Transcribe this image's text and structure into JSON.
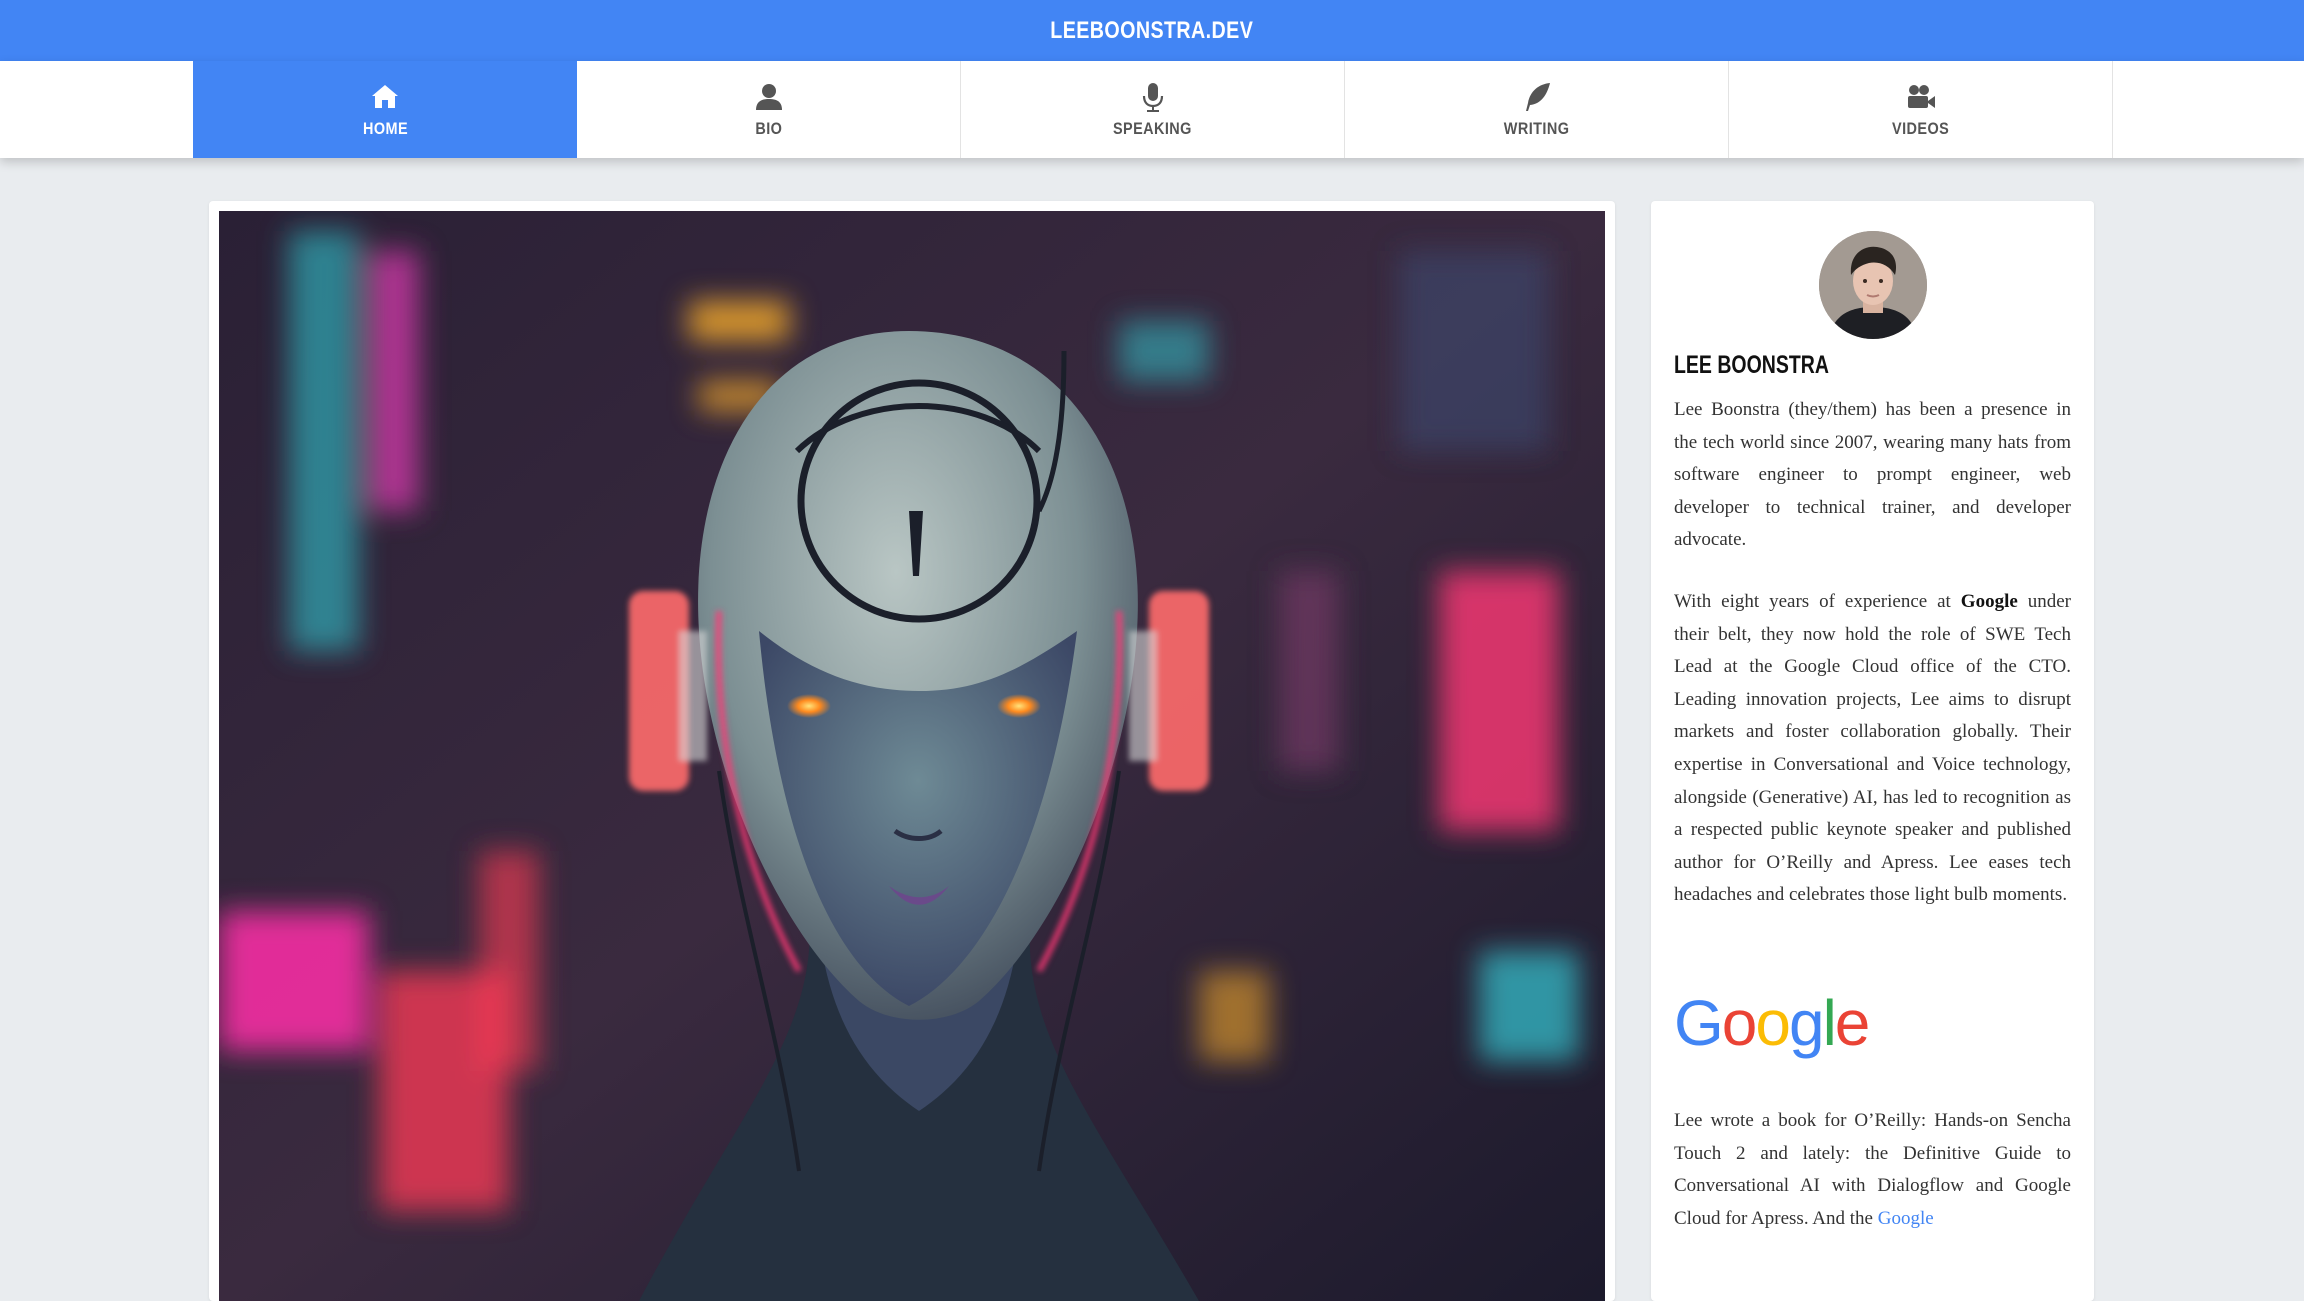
{
  "header": {
    "site_title": "LEEBOONSTRA.DEV",
    "brand_color": "#4285f4"
  },
  "nav": {
    "items": [
      {
        "label": "HOME",
        "icon": "home-icon",
        "active": true
      },
      {
        "label": "BIO",
        "icon": "user-icon",
        "active": false
      },
      {
        "label": "SPEAKING",
        "icon": "microphone-icon",
        "active": false
      },
      {
        "label": "WRITING",
        "icon": "feather-icon",
        "active": false
      },
      {
        "label": "VIDEOS",
        "icon": "video-camera-icon",
        "active": false
      }
    ]
  },
  "sidebar": {
    "name": "LEE BOONSTRA",
    "bio_p1": "Lee Boonstra (they/them) has been a presence in the tech world since 2007, wearing many hats from software engineer to prompt engineer, web developer to technical trainer, and developer advocate.",
    "bio_p2_before": "With eight years of experience at ",
    "bio_p2_bold": "Google",
    "bio_p2_after": " under their belt, they now hold the role of SWE Tech Lead at the Google Cloud office of the CTO. Leading innovation projects, Lee aims to disrupt markets and foster collaboration globally. Their expertise in Conversational and Voice technology, alongside (Generative) AI, has led to recognition as a respected public keynote speaker and published author for O’Reilly and Apress. Lee eases tech headaches and celebrates those light bulb moments.",
    "logo": {
      "letters": [
        "G",
        "o",
        "o",
        "g",
        "l",
        "e"
      ],
      "colors": [
        "#4285f4",
        "#ea4335",
        "#fbbc05",
        "#4285f4",
        "#34a853",
        "#ea4335"
      ]
    },
    "bio_p3_before": "Lee wrote a book for O’Reilly: Hands-on Sencha Touch 2 and lately: the Definitive Guide to Conversational AI with Dialogflow and Google Cloud for Apress. And the ",
    "bio_p3_link": "Google"
  }
}
